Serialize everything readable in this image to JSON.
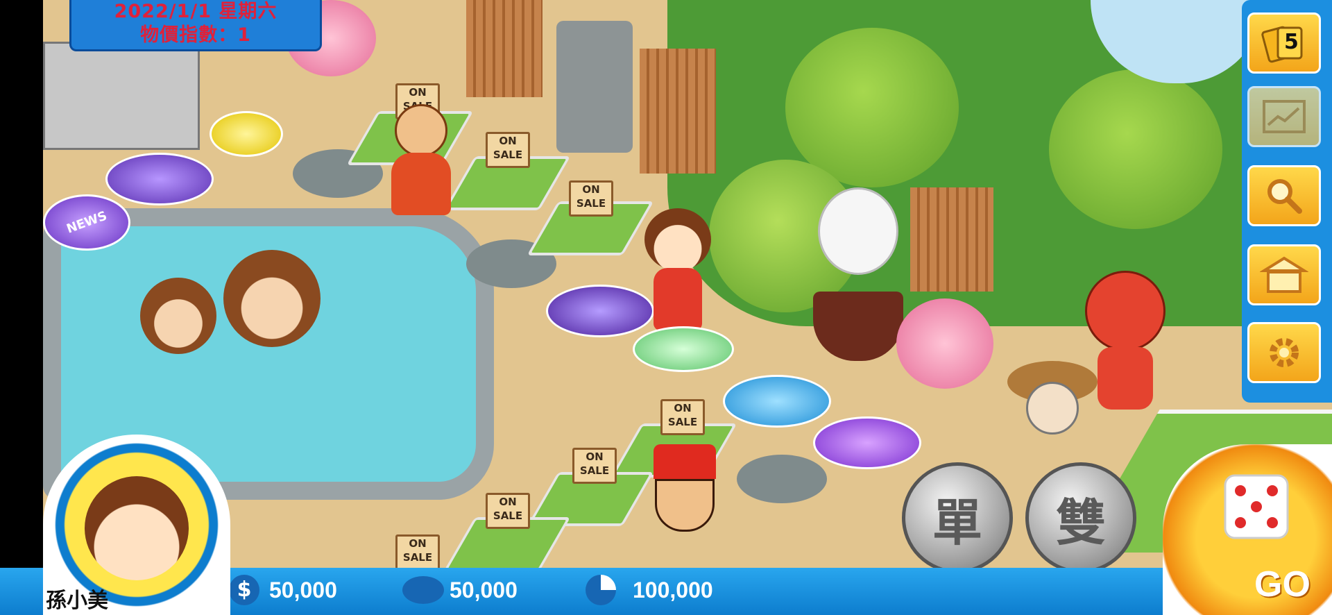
{
  "header": {
    "date_line": "2022/1/1 星期六",
    "price_index_line": "物價指數：1"
  },
  "sidebar": {
    "card_count": "5",
    "buttons": [
      {
        "icon": "cards-icon"
      },
      {
        "icon": "stock-chart-icon"
      },
      {
        "icon": "magnifier-icon"
      },
      {
        "icon": "shop-icon"
      },
      {
        "icon": "settings-gear-icon"
      }
    ]
  },
  "board": {
    "sale_sign_text": "ON SALE",
    "news_label": "NEWS"
  },
  "player": {
    "name": "孫小美",
    "cash": "50,000",
    "savings": "50,000",
    "total_assets": "100,000"
  },
  "controls": {
    "single_label": "單",
    "double_label": "雙",
    "go_label": "GO"
  },
  "colors": {
    "accent_blue": "#1c8fe0",
    "date_text": "#e0213a",
    "button_gold": "#f3a51a"
  }
}
